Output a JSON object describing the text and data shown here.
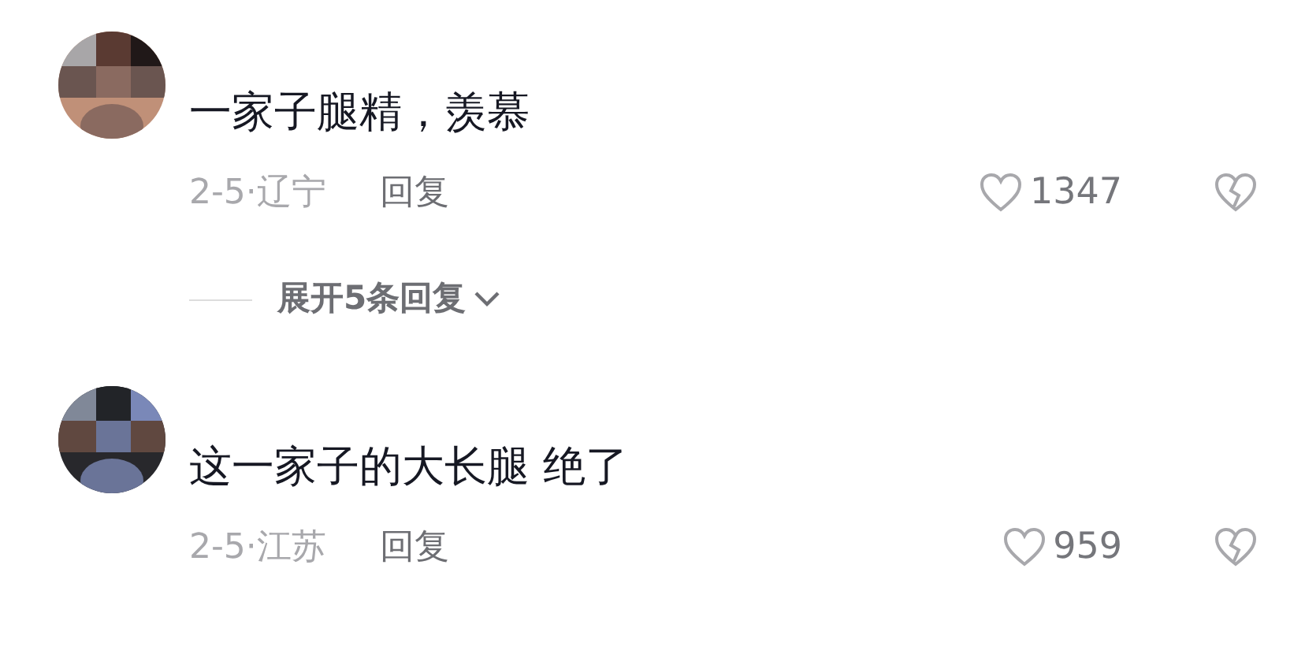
{
  "comments": [
    {
      "kind": "comment",
      "text": "一家子腿精，羡慕",
      "meta": "2-5·辽宁",
      "reply": "回复",
      "likes": "1347",
      "expand": "展开5条回复"
    },
    {
      "kind": "comment",
      "text": "这一家子的大长腿 绝了",
      "meta": "2-5·江苏",
      "reply": "回复",
      "likes": "959"
    }
  ]
}
